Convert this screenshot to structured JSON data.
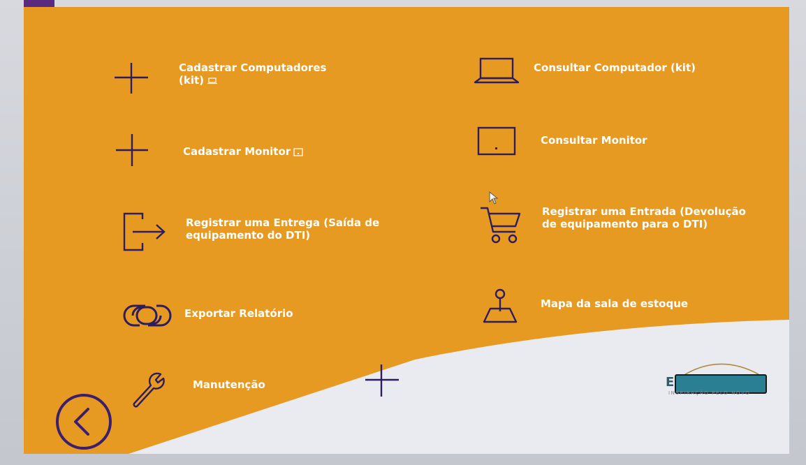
{
  "colors": {
    "panel_orange": "#e69a22",
    "icon_stroke": "#2d1c5e",
    "label_white": "#ffffff",
    "back_purple": "#3b1f6e",
    "corner_purple": "#5a2a7e",
    "logo_redact": "#2a7f92",
    "logo_arc": "#b08a3a"
  },
  "menu": {
    "cadastrar_computadores": {
      "label_line1": "Cadastrar Computadores",
      "label_line2": "(kit)",
      "icon": "plus-icon",
      "mini_icon": "laptop-icon"
    },
    "consultar_computador": {
      "label": "Consultar Computador (kit)",
      "icon": "laptop-icon"
    },
    "cadastrar_monitor": {
      "label": "Cadastrar Monitor",
      "icon": "plus-icon",
      "mini_icon": "monitor-icon"
    },
    "consultar_monitor": {
      "label": "Consultar Monitor",
      "icon": "monitor-icon"
    },
    "registrar_entrega": {
      "label_line1": "Registrar uma Entrega (Saída de",
      "label_line2": "equipamento do DTI)",
      "icon": "exit-icon"
    },
    "registrar_entrada": {
      "label_line1": "Registrar uma Entrada (Devolução",
      "label_line2": "de equipamento para o DTI)",
      "icon": "cart-icon"
    },
    "exportar_relatorio": {
      "label": "Exportar Relatório",
      "icon": "link-icon"
    },
    "mapa_sala": {
      "label": "Mapa da sala de estoque",
      "icon": "map-pin-icon"
    },
    "manutencao": {
      "label": "Manutenção",
      "icon": "wrench-icon"
    }
  },
  "back_button": {
    "icon": "chevron-left-icon"
  },
  "floating_add": {
    "icon": "plus-icon"
  },
  "logo": {
    "letter": "E",
    "tagline": "INSPIRAÇÃO PELO NOVO"
  }
}
